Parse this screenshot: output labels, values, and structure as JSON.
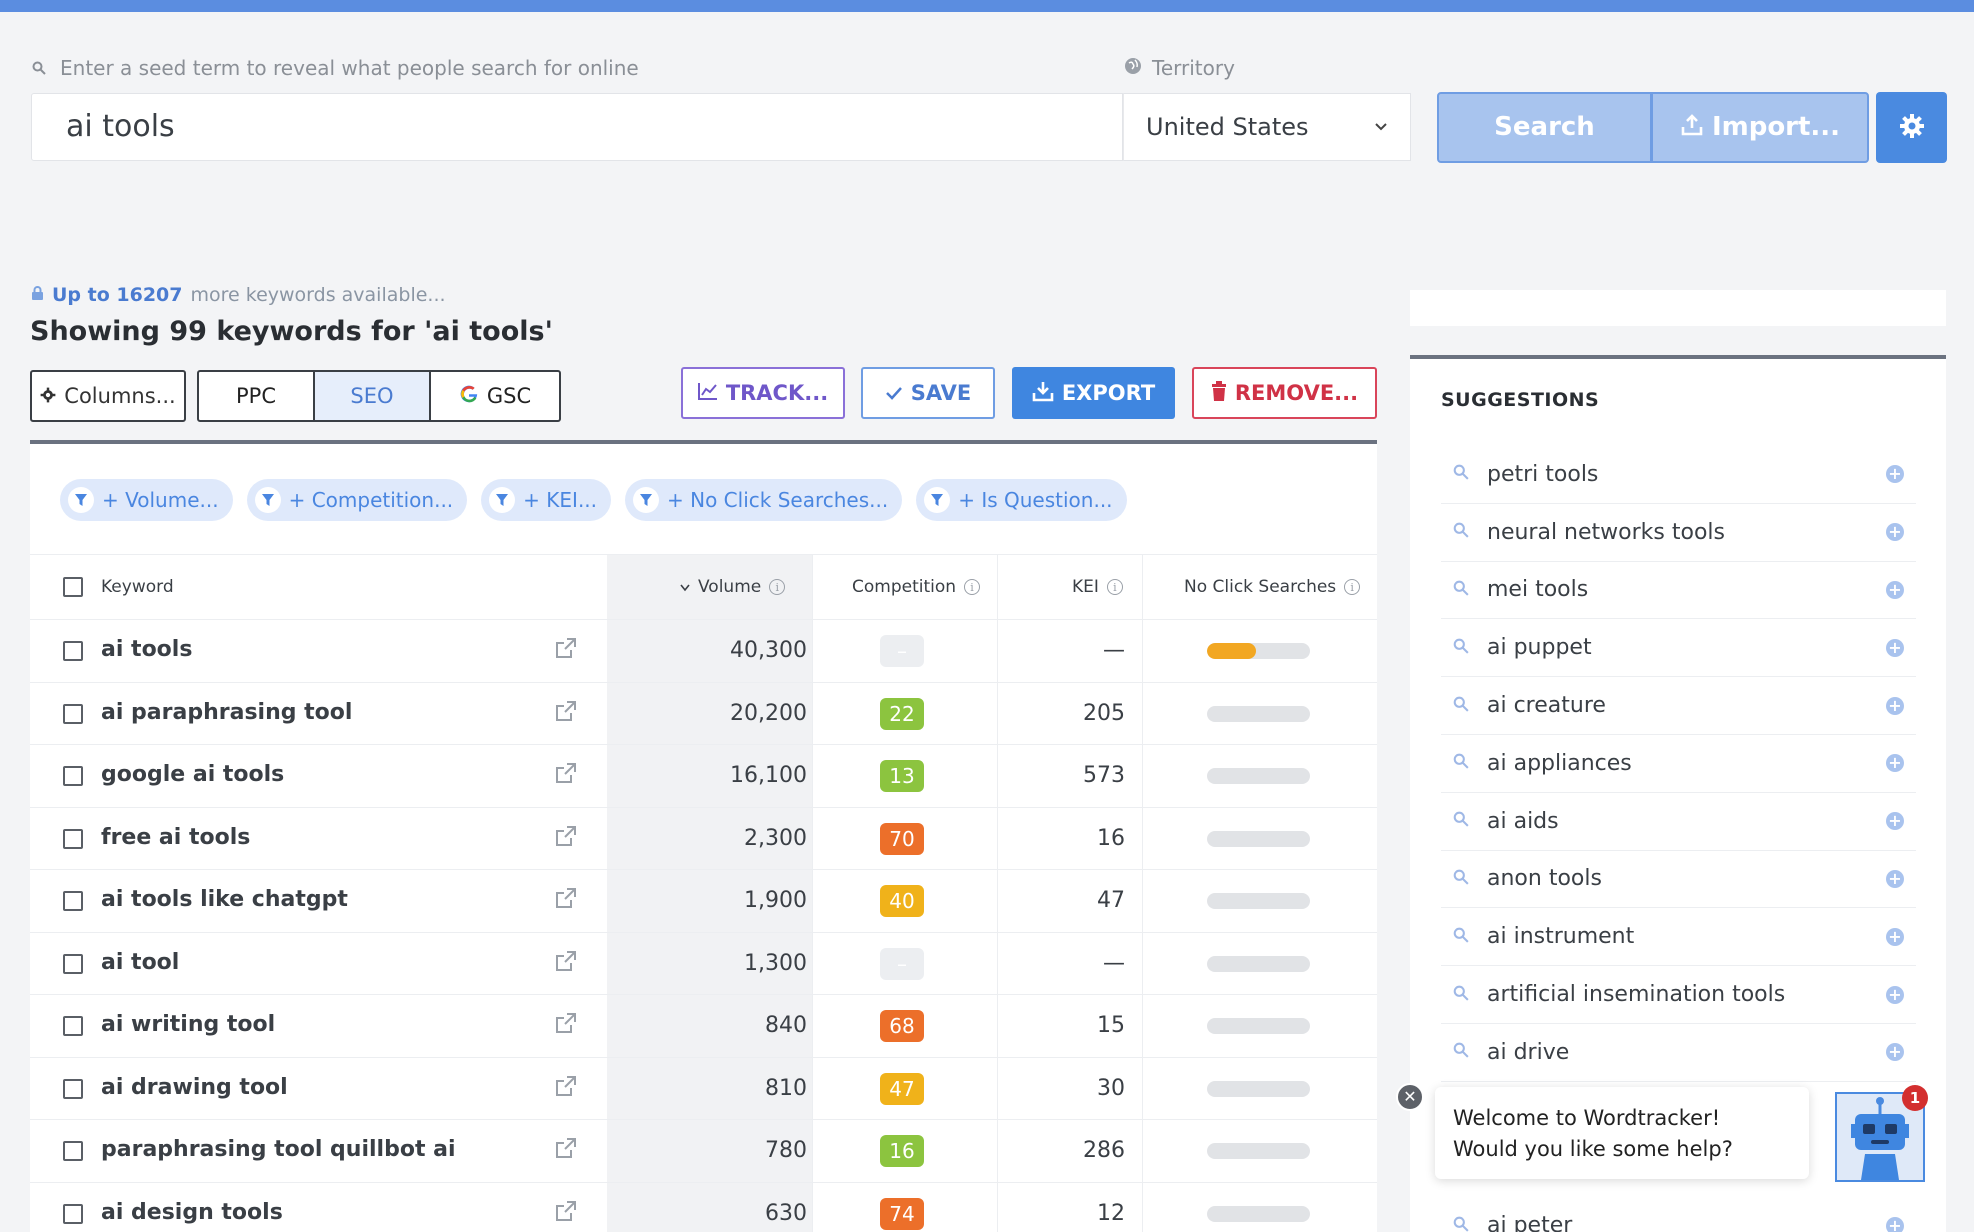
{
  "search": {
    "hint": "Enter a seed term to reveal what people search for online",
    "territory_label": "Territory",
    "query": "ai tools",
    "territory": "United States",
    "search_label": "Search",
    "import_label": "Import..."
  },
  "summary": {
    "avail_prefix": "Up to 16207",
    "avail_suffix": "more keywords available...",
    "showing": "Showing 99 keywords for 'ai tools'"
  },
  "toolbar": {
    "columns": "Columns...",
    "ppc": "PPC",
    "seo": "SEO",
    "gsc": "GSC",
    "track": "TRACK...",
    "save": "SAVE",
    "export": "EXPORT",
    "remove": "REMOVE..."
  },
  "filters": [
    "+ Volume...",
    "+ Competition...",
    "+ KEI...",
    "+ No Click Searches...",
    "+ Is Question..."
  ],
  "table": {
    "headers": {
      "keyword": "Keyword",
      "volume": "Volume",
      "competition": "Competition",
      "kei": "KEI",
      "no_click": "No Click Searches"
    },
    "rows": [
      {
        "keyword": "ai tools",
        "volume": "40,300",
        "competition": "–",
        "kei": "—",
        "no_click": 0.48
      },
      {
        "keyword": "ai paraphrasing tool",
        "volume": "20,200",
        "competition": "22",
        "kei": "205",
        "no_click": 0
      },
      {
        "keyword": "google ai tools",
        "volume": "16,100",
        "competition": "13",
        "kei": "573",
        "no_click": 0
      },
      {
        "keyword": "free ai tools",
        "volume": "2,300",
        "competition": "70",
        "kei": "16",
        "no_click": 0
      },
      {
        "keyword": "ai tools like chatgpt",
        "volume": "1,900",
        "competition": "40",
        "kei": "47",
        "no_click": 0
      },
      {
        "keyword": "ai tool",
        "volume": "1,300",
        "competition": "–",
        "kei": "—",
        "no_click": 0
      },
      {
        "keyword": "ai writing tool",
        "volume": "840",
        "competition": "68",
        "kei": "15",
        "no_click": 0
      },
      {
        "keyword": "ai drawing tool",
        "volume": "810",
        "competition": "47",
        "kei": "30",
        "no_click": 0
      },
      {
        "keyword": "paraphrasing tool quillbot ai",
        "volume": "780",
        "competition": "16",
        "kei": "286",
        "no_click": 0
      },
      {
        "keyword": "ai design tools",
        "volume": "630",
        "competition": "74",
        "kei": "12",
        "no_click": 0
      }
    ]
  },
  "competition_colors": {
    "low": "#8cc43f",
    "mid": "#f0b21a",
    "high": "#ec6f2a",
    "none": "#eceef1"
  },
  "suggestions": {
    "title": "SUGGESTIONS",
    "items": [
      "petri tools",
      "neural networks tools",
      "mei tools",
      "ai puppet",
      "ai creature",
      "ai appliances",
      "ai aids",
      "anon tools",
      "ai instrument",
      "artificial insemination tools",
      "ai drive",
      "",
      "",
      "ai peter"
    ]
  },
  "chat": {
    "message": "Welcome to Wordtracker! Would you like some help?",
    "badge": "1"
  }
}
